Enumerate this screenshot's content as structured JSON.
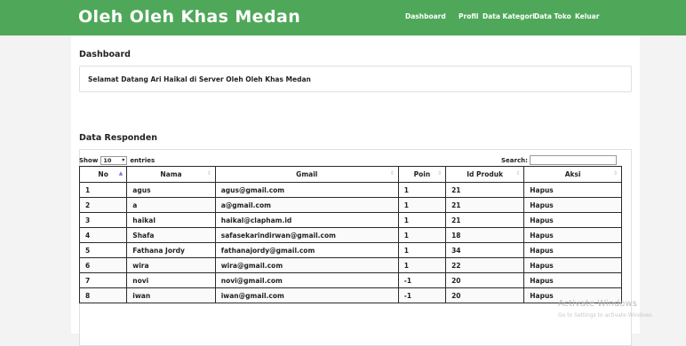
{
  "navbar": {
    "brand": "Oleh Oleh Khas Medan",
    "links": [
      "Dashboard",
      "Profil",
      "Data Kategori",
      "Data Toko",
      "Keluar"
    ]
  },
  "dashboard": {
    "title": "Dashboard",
    "welcome": "Selamat Datang Ari Haikal di Server Oleh Oleh Khas Medan"
  },
  "responden": {
    "title": "Data Responden",
    "show_label": "Show",
    "entries_value": "10",
    "entries_label": "entries",
    "search_label": "Search:",
    "search_value": "",
    "columns": [
      "No",
      "Nama",
      "Gmail",
      "Poin",
      "Id Produk",
      "Aksi"
    ],
    "rows": [
      {
        "no": "1",
        "nama": "agus",
        "gmail": "agus@gmail.com",
        "poin": "1",
        "id_produk": "21",
        "aksi": "Hapus"
      },
      {
        "no": "2",
        "nama": "a",
        "gmail": "a@gmail.com",
        "poin": "1",
        "id_produk": "21",
        "aksi": "Hapus"
      },
      {
        "no": "3",
        "nama": "haikal",
        "gmail": "haikal@clapham.id",
        "poin": "1",
        "id_produk": "21",
        "aksi": "Hapus"
      },
      {
        "no": "4",
        "nama": "Shafa",
        "gmail": "safasekarindirwan@gmail.com",
        "poin": "1",
        "id_produk": "18",
        "aksi": "Hapus"
      },
      {
        "no": "5",
        "nama": "Fathana Jordy",
        "gmail": "fathanajordy@gmail.com",
        "poin": "1",
        "id_produk": "34",
        "aksi": "Hapus"
      },
      {
        "no": "6",
        "nama": "wira",
        "gmail": "wira@gmail.com",
        "poin": "1",
        "id_produk": "22",
        "aksi": "Hapus"
      },
      {
        "no": "7",
        "nama": "novi",
        "gmail": "novi@gmail.com",
        "poin": "-1",
        "id_produk": "20",
        "aksi": "Hapus"
      },
      {
        "no": "8",
        "nama": "iwan",
        "gmail": "iwan@gmail.com",
        "poin": "-1",
        "id_produk": "20",
        "aksi": "Hapus"
      }
    ]
  },
  "watermark": {
    "title": "Activate Windows",
    "subtitle": "Go to Settings to activate Windows."
  }
}
